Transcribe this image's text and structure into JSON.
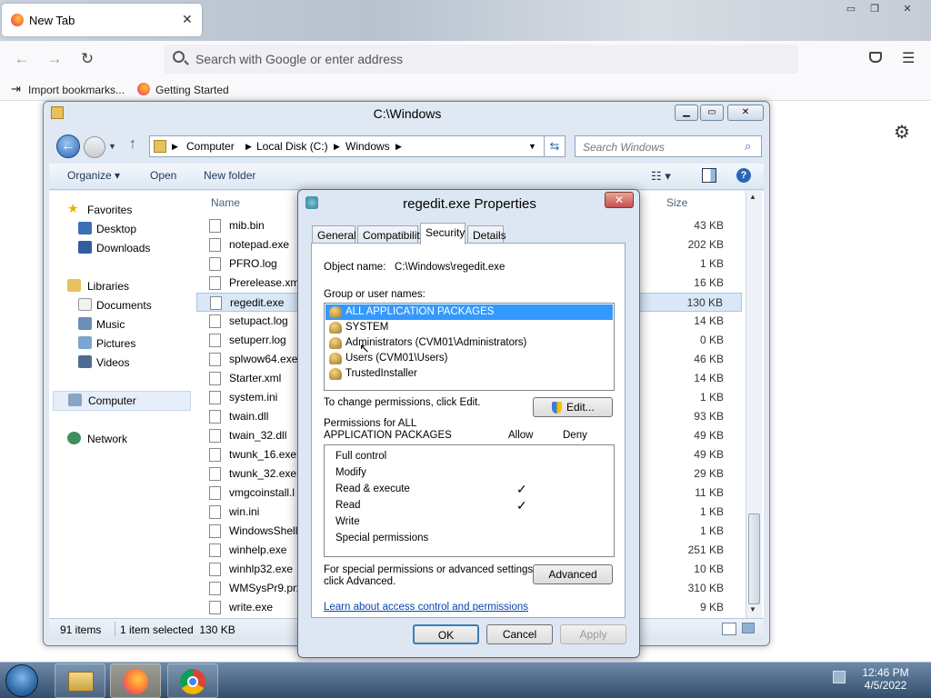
{
  "browser": {
    "tab_title": "New Tab",
    "tab_close": "✕",
    "window_controls": [
      "▭",
      "❐",
      "✕"
    ],
    "url_placeholder": "Search with Google or enter address",
    "bookmarks": [
      "Import bookmarks...",
      "Getting Started"
    ]
  },
  "explorer": {
    "title": "C:\\Windows",
    "breadcrumb": [
      "Computer",
      "Local Disk (C:)",
      "Windows"
    ],
    "search_placeholder": "Search Windows",
    "toolbar": {
      "organize": "Organize ▾",
      "open": "Open",
      "new_folder": "New folder"
    },
    "column_name": "Name",
    "column_size": "Size",
    "nav": {
      "favorites": "Favorites",
      "fav_items": [
        "Desktop",
        "Downloads"
      ],
      "libraries": "Libraries",
      "lib_items": [
        "Documents",
        "Music",
        "Pictures",
        "Videos"
      ],
      "computer": "Computer",
      "network": "Network"
    },
    "files": [
      {
        "name": "mib.bin",
        "size": "43 KB"
      },
      {
        "name": "notepad.exe",
        "size": "202 KB"
      },
      {
        "name": "PFRO.log",
        "size": "1 KB"
      },
      {
        "name": "Prerelease.xml",
        "size": "16 KB"
      },
      {
        "name": "regedit.exe",
        "size": "130 KB"
      },
      {
        "name": "setupact.log",
        "size": "14 KB"
      },
      {
        "name": "setuperr.log",
        "size": "0 KB"
      },
      {
        "name": "splwow64.exe",
        "size": "46 KB"
      },
      {
        "name": "Starter.xml",
        "size": "14 KB"
      },
      {
        "name": "system.ini",
        "size": "1 KB"
      },
      {
        "name": "twain.dll",
        "size": "93 KB"
      },
      {
        "name": "twain_32.dll",
        "size": "49 KB"
      },
      {
        "name": "twunk_16.exe",
        "size": "49 KB"
      },
      {
        "name": "twunk_32.exe",
        "size": "29 KB"
      },
      {
        "name": "vmgcoinstall.l",
        "size": "11 KB"
      },
      {
        "name": "win.ini",
        "size": "1 KB"
      },
      {
        "name": "WindowsShell",
        "size": "1 KB"
      },
      {
        "name": "winhelp.exe",
        "size": "251 KB"
      },
      {
        "name": "winhlp32.exe",
        "size": "10 KB"
      },
      {
        "name": "WMSysPr9.prx",
        "size": "310 KB"
      },
      {
        "name": "write.exe",
        "size": "9 KB"
      }
    ],
    "status_count": "91 items",
    "status_selected": "1 item selected  130 KB"
  },
  "dialog": {
    "title": "regedit.exe Properties",
    "tabs": [
      "General",
      "Compatibility",
      "Security",
      "Details"
    ],
    "object_label": "Object name:",
    "object_value": "C:\\Windows\\regedit.exe",
    "groups_label": "Group or user names:",
    "groups": [
      "ALL APPLICATION PACKAGES",
      "SYSTEM",
      "Administrators (CVM01\\Administrators)",
      "Users (CVM01\\Users)",
      "TrustedInstaller"
    ],
    "change_text": "To change permissions, click Edit.",
    "edit_button": "Edit...",
    "perm_header_1": "Permissions for ALL",
    "perm_header_2": "APPLICATION PACKAGES",
    "allow": "Allow",
    "deny": "Deny",
    "permissions": [
      {
        "name": "Full control",
        "allow": ""
      },
      {
        "name": "Modify",
        "allow": ""
      },
      {
        "name": "Read & execute",
        "allow": "✓"
      },
      {
        "name": "Read",
        "allow": "✓"
      },
      {
        "name": "Write",
        "allow": ""
      },
      {
        "name": "Special permissions",
        "allow": ""
      }
    ],
    "special_text_1": "For special permissions or advanced settings,",
    "special_text_2": "click Advanced.",
    "advanced_button": "Advanced",
    "learn_link": "Learn about access control and permissions",
    "ok": "OK",
    "cancel": "Cancel",
    "apply": "Apply",
    "close": "✕"
  },
  "taskbar": {
    "time": "12:46 PM",
    "date": "4/5/2022"
  }
}
